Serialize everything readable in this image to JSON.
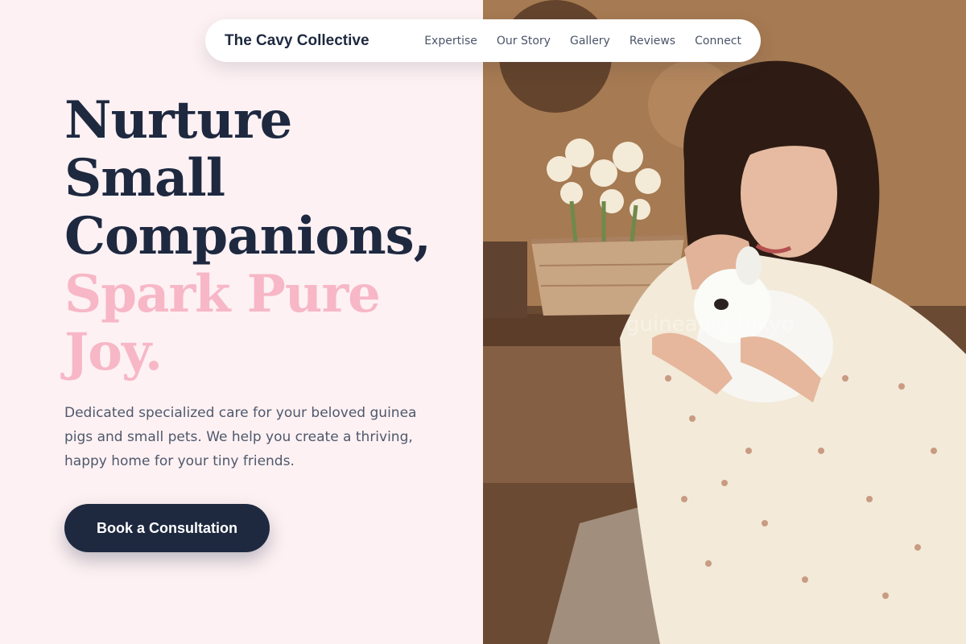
{
  "nav": {
    "brand": "The Cavy Collective",
    "links": [
      {
        "label": "Expertise"
      },
      {
        "label": "Our Story"
      },
      {
        "label": "Gallery"
      },
      {
        "label": "Reviews"
      },
      {
        "label": "Connect"
      }
    ]
  },
  "hero": {
    "headline_lines": [
      "Nurture",
      "Small",
      "Companions,"
    ],
    "highlight_lines": [
      "Spark Pure",
      "Joy."
    ],
    "subtitle": "Dedicated specialized care for your beloved guinea pigs and small pets. We help you create a thriving, happy home for your tiny friends.",
    "cta_label": "Book a Consultation"
  },
  "photo": {
    "alt": "Woman in a floral dress holding a small white fluffy pet close to her face, with flowers in wicker baskets in the background",
    "watermark": "guineapig tokyo"
  },
  "colors": {
    "background": "#fdf1f3",
    "navy": "#1e2940",
    "pink": "#f7b7c6",
    "muted_text": "#4f586b"
  }
}
